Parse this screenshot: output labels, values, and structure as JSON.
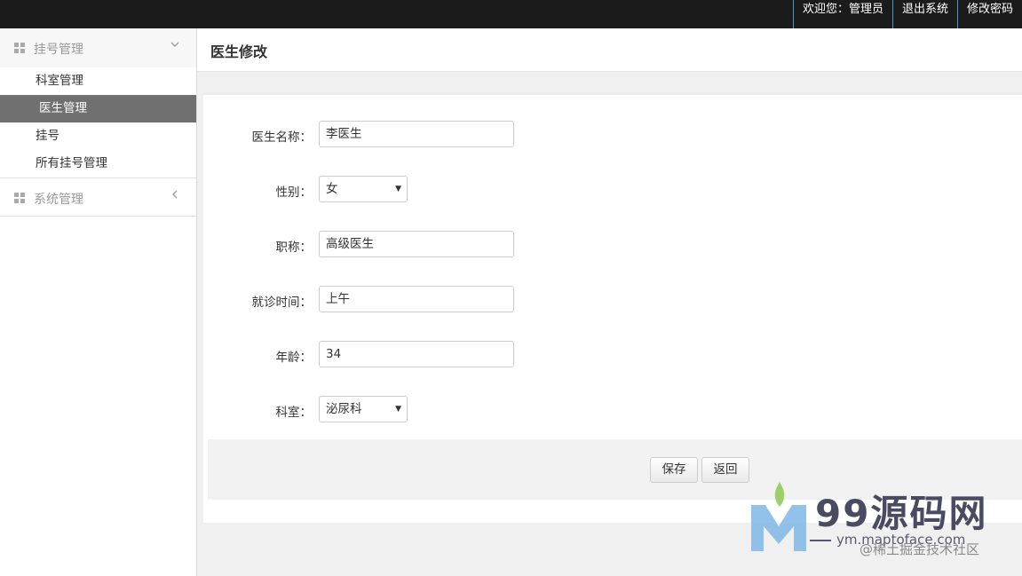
{
  "topbar": {
    "welcome": "欢迎您：管理员",
    "logout": "退出系统",
    "change_password": "修改密码"
  },
  "sidebar": {
    "groups": [
      {
        "label": "挂号管理",
        "icon": "grid-icon",
        "expanded": true,
        "items": [
          {
            "label": "科室管理",
            "active": false
          },
          {
            "label": "医生管理",
            "active": true
          },
          {
            "label": "挂号",
            "active": false
          },
          {
            "label": "所有挂号管理",
            "active": false
          }
        ]
      },
      {
        "label": "系统管理",
        "icon": "grid-icon",
        "expanded": false
      }
    ]
  },
  "page": {
    "title": "医生修改"
  },
  "form": {
    "name_label": "医生名称：",
    "name_value": "李医生",
    "gender_label": "性别：",
    "gender_value": "女",
    "title_label": "职称：",
    "title_value": "高级医生",
    "time_label": "就诊时间：",
    "time_value": "上午",
    "age_label": "年龄：",
    "age_value": "34",
    "dept_label": "科室：",
    "dept_value": "泌尿科"
  },
  "actions": {
    "save": "保存",
    "back": "返回"
  },
  "watermark": {
    "brand": "99源码网",
    "url": "ym.maptoface.com",
    "sub": "@稀土掘金技术社区"
  },
  "colors": {
    "topbar_bg": "#1b1b1b",
    "topbar_divider": "#3a9ad9",
    "active_menu_bg": "#707070"
  }
}
